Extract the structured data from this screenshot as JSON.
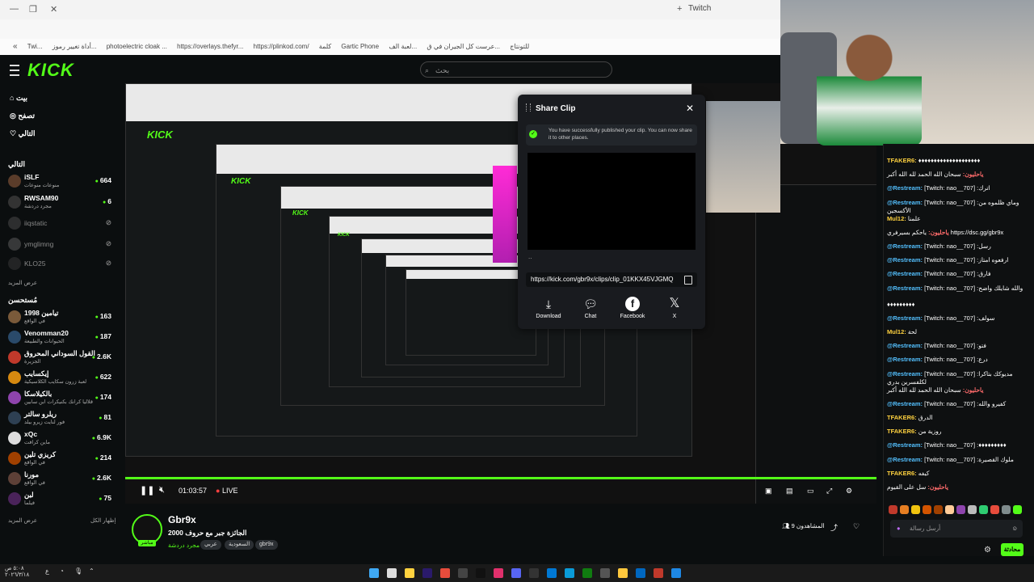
{
  "browser": {
    "tab_title": "Twitch",
    "bookmarks": [
      "Twi...",
      "أداة تغيير رموز...",
      "photoelectric cloak ...",
      "https://overlays.thefyr...",
      "https://plinkod.com/",
      "كلمة",
      "Gartic Phone",
      "لعبة الف...",
      "عرست كل الجيران في ق...",
      "للتونتاج"
    ]
  },
  "kick": {
    "logo": "KICK",
    "search_placeholder": "بحث"
  },
  "sidebar": {
    "nav": [
      "بيت",
      "تصفح",
      "التالي"
    ],
    "following_header": "التالي",
    "following": [
      {
        "name": "iSLF",
        "category": "منوعات منوعات",
        "viewers": "664",
        "online": true
      },
      {
        "name": "RWSAM90",
        "category": "مجرد دردشة",
        "viewers": "6",
        "online": true
      },
      {
        "name": "iiqstatic",
        "category": "",
        "viewers": "",
        "online": false
      },
      {
        "name": "ymglimng",
        "category": "",
        "viewers": "",
        "online": false
      },
      {
        "name": "KLO25",
        "category": "",
        "viewers": "",
        "online": false
      }
    ],
    "show_more_1": "عرض المزيد",
    "recommended_header": "مُستحسن",
    "recommended": [
      {
        "name": "تيامين 1998",
        "category": "في الواقع",
        "viewers": "163"
      },
      {
        "name": "Venomman20",
        "category": "الحيوانات والطبيعة",
        "viewers": "187"
      },
      {
        "name": "القول السوداني المحروق",
        "category": "الجزيرة",
        "viewers": "2.6K"
      },
      {
        "name": "إيكسايب",
        "category": "لعبة زرون سكايب الكلاسيكية",
        "viewers": "622"
      },
      {
        "name": "بالكيلاسكا",
        "category": "قلاليا كرانك بكنيكرات ابن سابين",
        "viewers": "174"
      },
      {
        "name": "ريلرو سالتر",
        "category": "فور لنايت زيرو بيلد",
        "viewers": "81"
      },
      {
        "name": "xQc",
        "category": "ماين كرافت",
        "viewers": "6.9K"
      },
      {
        "name": "كريزي تلين",
        "category": "في الواقع",
        "viewers": "214"
      },
      {
        "name": "مورنا",
        "category": "في الواقع",
        "viewers": "2.6K"
      },
      {
        "name": "لبن",
        "category": "فيلما",
        "viewers": "75"
      }
    ],
    "show_more_2": "عرض المزيد",
    "show_all": "إظهار الكل"
  },
  "player": {
    "time": "01:03:57",
    "live_label": "LIVE"
  },
  "modal": {
    "title": "Share Clip",
    "notice": "You have successfully published your clip. You can now share it to other places.",
    "dots": "..",
    "url": "https://kick.com/gbr9x/clips/clip_01KKX45VJGMQ",
    "buttons": [
      {
        "label": "Download",
        "icon": "download-icon"
      },
      {
        "label": "Chat",
        "icon": "chat-icon"
      },
      {
        "label": "Facebook",
        "icon": "facebook-icon"
      },
      {
        "label": "X",
        "icon": "x-icon"
      }
    ]
  },
  "stream": {
    "name": "Gbr9x",
    "title": "2000 الجائزة جبر مع حروف",
    "category": "مجرد دردشة",
    "tags": [
      "عربي",
      "السعودية",
      "gbr9x"
    ],
    "viewers": "المشاهدون 9",
    "live": "مباشر"
  },
  "chat": {
    "messages": [
      {
        "user": "TFAKER6:",
        "text": "♦♦♦♦♦♦♦♦♦♦♦♦♦♦♦♦♦♦♦♦",
        "color": "y"
      },
      {
        "user": "ياحليون:",
        "text": "سبحان الله الحمد لله الله أكبر",
        "color": "r"
      },
      {
        "user": "@Restream:",
        "text": "[Twitch: nao__707] :اترك",
        "color": "b"
      },
      {
        "user": "@Restream:",
        "text": "[Twitch: nao__707] :وماي ظلموه من الأكسجين",
        "color": "b"
      },
      {
        "user": "Mul12:",
        "text": "علمنا",
        "color": "y"
      },
      {
        "user": "ياحليون:",
        "text": "ياحكم بسيرفري https://dsc.gg/gbr9x",
        "color": "r"
      },
      {
        "user": "@Restream:",
        "text": "[Twitch: nao__707] :رسل",
        "color": "b"
      },
      {
        "user": "@Restream:",
        "text": "[Twitch: nao__707] :ارفعوه امتاز",
        "color": "b"
      },
      {
        "user": "@Restream:",
        "text": "[Twitch: nao__707] :فارق",
        "color": "b"
      },
      {
        "user": "@Restream:",
        "text": "[Twitch: nao__707] :والله شايلك واضح",
        "color": "b"
      },
      {
        "user": "",
        "text": "♦♦♦♦♦♦♦♦♦",
        "color": "b"
      },
      {
        "user": "@Restream:",
        "text": "[Twitch: nao__707] :سولف",
        "color": "b"
      },
      {
        "user": "Mul12:",
        "text": "لحة",
        "color": "y"
      },
      {
        "user": "@Restream:",
        "text": "[Twitch: nao__707] :فتو",
        "color": "b"
      },
      {
        "user": "@Restream:",
        "text": "[Twitch: nao__707] :درع",
        "color": "b"
      },
      {
        "user": "@Restream:",
        "text": "[Twitch: nao__707] :مديوكك بتاكرا لكلفسرين بدري",
        "color": "b"
      },
      {
        "user": "ياحليون:",
        "text": "سبحان الله الحمد لله الله أكبر",
        "color": "r"
      },
      {
        "user": "@Restream:",
        "text": "[Twitch: nao__707] :كفيرو والله",
        "color": "b"
      },
      {
        "user": "TFAKER6:",
        "text": "الدرق",
        "color": "y"
      },
      {
        "user": "TFAKER6:",
        "text": "روزية من",
        "color": "y"
      },
      {
        "user": "@Restream:",
        "text": "[Twitch: nao__707] :♦♦♦♦♦♦♦♦♦",
        "color": "b"
      },
      {
        "user": "@Restream:",
        "text": "[Twitch: nao__707] :ملوك القصيرة",
        "color": "b"
      },
      {
        "user": "TFAKER6:",
        "text": "كيفه",
        "color": "y"
      },
      {
        "user": "ياحليون:",
        "text": "سل على القيوم",
        "color": "r"
      }
    ],
    "input_placeholder": "أرسل رسالة",
    "send_label": "محادثة"
  },
  "taskbar": {
    "time": "٥:٠٨ ص",
    "date": "٢٠٢٦/٣/١٨"
  },
  "colors": {
    "accent": "#53fc18",
    "background": "#0b0e0f",
    "chat_user": "#53c0ff"
  }
}
